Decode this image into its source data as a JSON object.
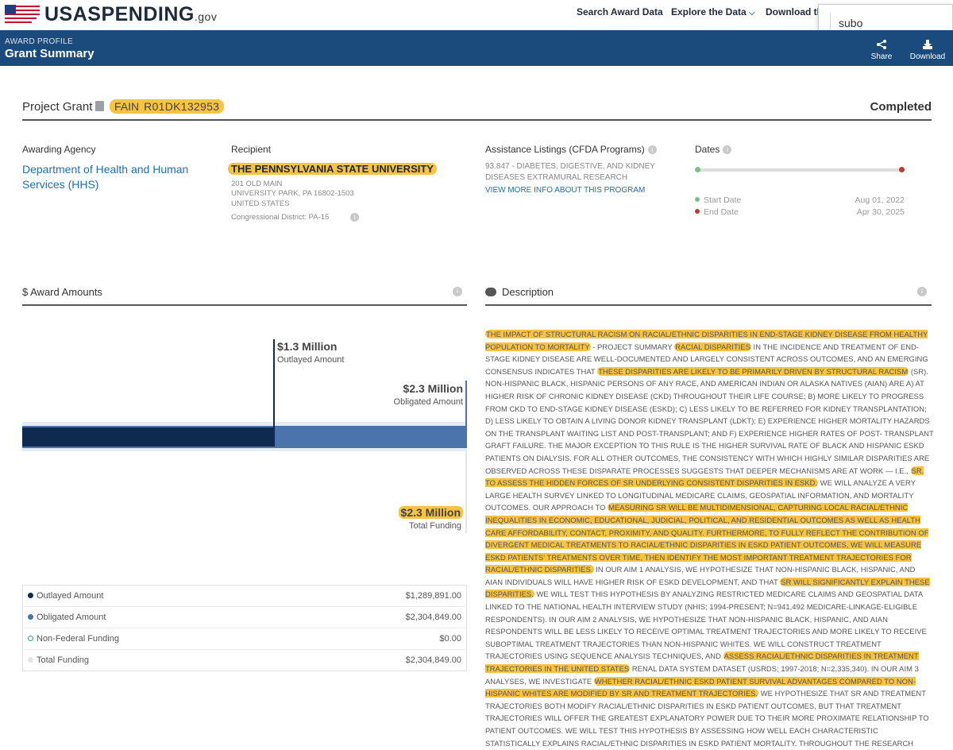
{
  "nav": {
    "logo_text": "USASPENDING",
    "logo_suffix": ".gov",
    "links": [
      "Search Award Data",
      "Explore the Data",
      "Download th"
    ],
    "explore_chevron": "⌵",
    "search_value": "subo"
  },
  "header": {
    "eyebrow": "AWARD PROFILE",
    "title": "Grant Summary",
    "share_label": "Share",
    "download_label": "Download"
  },
  "summary": {
    "award_type": "Project Grant",
    "fain_label": "FAIN",
    "fain_value": "R01DK132953",
    "status": "Completed",
    "awarding_agency_label": "Awarding Agency",
    "awarding_agency": "Department of Health and Human Services (HHS)",
    "recipient_label": "Recipient",
    "recipient_name": "THE PENNSYLVANIA STATE UNIVERSITY",
    "address_line1": "201 OLD MAIN",
    "address_line2": "UNIVERSITY PARK, PA 16802-1503",
    "address_line3": "UNITED STATES",
    "congressional_district": "Congressional District: PA-15",
    "cfda_label": "Assistance Listings (CFDA Programs)",
    "cfda_program": "93.847 - DIABETES, DIGESTIVE, AND KIDNEY DISEASES EXTRAMURAL RESEARCH",
    "cfda_link": "VIEW MORE INFO ABOUT THIS PROGRAM",
    "dates_label": "Dates",
    "start_label": "Start Date",
    "start_value": "Aug 01, 2022",
    "end_label": "End Date",
    "end_value": "Apr 30, 2025"
  },
  "amounts": {
    "section_title": "$ Award Amounts",
    "outlayed_big": "$1.3 Million",
    "outlayed_caption": "Outlayed Amount",
    "obligated_big": "$2.3 Million",
    "obligated_caption": "Obligated Amount",
    "total_big": "$2.3 Million",
    "total_caption": "Total Funding",
    "outlayed_fraction": 0.56,
    "obligated_fraction": 1.0,
    "legend": [
      {
        "label": "Outlayed Amount",
        "value": "$1,289,891.00",
        "color": "#0e2a4e"
      },
      {
        "label": "Obligated Amount",
        "value": "$2,304,849.00",
        "color": "#4b74ad"
      },
      {
        "label": "Non-Federal Funding",
        "value": "$0.00",
        "color": "#2aa198"
      },
      {
        "label": "Total Funding",
        "value": "$2,304,849.00",
        "color": "#e2e6ea"
      }
    ]
  },
  "description": {
    "section_title": "Description",
    "segments": [
      {
        "t": "THE IMPACT OF STRUCTURAL RACISM ON RACIAL/ETHNIC DISPARITIES IN END-STAGE KIDNEY DISEASE FROM HEALTHY POPULATION TO MORTALITY",
        "h": true
      },
      {
        "t": " - PROJECT SUMMARY ",
        "h": false
      },
      {
        "t": "RACIAL DISPARITIES",
        "h": true
      },
      {
        "t": " IN THE INCIDENCE AND TREATMENT OF END-STAGE KIDNEY DISEASE ARE WELL-DOCUMENTED AND LARGELY CONSISTENT ACROSS OUTCOMES, AND AN EMERGING CONSENSUS INDICATES THAT ",
        "h": false
      },
      {
        "t": "THESE DISPARITIES ARE LIKELY TO BE PRIMARILY DRIVEN BY STRUCTURAL RACISM",
        "h": true
      },
      {
        "t": " (SR). NON-HISPANIC BLACK, HISPANIC PERSONS OF ANY RACE, AND AMERICAN INDIAN OR ALASKA NATIVES (AIAN) ARE A) AT HIGHER RISK OF CHRONIC KIDNEY DISEASE (CKD) THROUGHOUT THEIR LIFE COURSE; B) MORE LIKELY TO PROGRESS FROM CKD TO END-STAGE KIDNEY DISEASE (ESKD); C) LESS LIKELY TO BE REFERRED FOR KIDNEY TRANSPLANTATION; D) LESS LIKELY TO OBTAIN A LIVING DONOR KIDNEY TRANSPLANT (LDKT); E) EXPERIENCE HIGHER MORTALITY HAZARDS ON THE TRANSPLANT WAITING LIST AND POST-TRANSPLANT; AND F) EXPERIENCE HIGHER RATES OF POST- TRANSPLANT GRAFT FAILURE. THE MAJOR EXCEPTION TO THIS RULE IS THE HIGHER SURVIVAL RATE OF BLACK AND HISPANIC ESKD PATIENTS ON DIALYSIS. FOR ALL OTHER OUTCOMES, THE CONSISTENCY WITH WHICH HIGHLY SIMILAR DISPARITIES ARE OBSERVED ACROSS THESE DISPARATE PROCESSES SUGGESTS THAT DEEPER MECHANISMS ARE AT WORK — I.E., ",
        "h": false
      },
      {
        "t": "SR. TO ASSESS THE HIDDEN FORCES OF SR UNDERLYING CONSISTENT DISPARITIES IN ESKD,",
        "h": true
      },
      {
        "t": " WE WILL ANALYZE A VERY LARGE HEALTH SURVEY LINKED TO LONGITUDINAL MEDICARE CLAIMS, GEOSPATIAL INFORMATION, AND MORTALITY OUTCOMES. OUR APPROACH TO ",
        "h": false
      },
      {
        "t": "MEASURING SR WILL BE MULTIDIMENSIONAL, CAPTURING LOCAL RACIAL/ETHNIC INEQUALITIES IN ECONOMIC, EDUCATIONAL, JUDICIAL, POLITICAL, AND RESIDENTIAL OUTCOMES AS WELL AS HEALTH CARE AFFORDABILITY, CONTACT, PROXIMITY, AND QUALITY. FURTHERMORE, TO FULLY REFLECT THE CONTRIBUTION OF DIVERGENT MEDICAL TREATMENTS TO RACIAL/ETHNIC DISPARITIES IN ESKD PATIENT OUTCOMES, WE WILL MEASURE ESKD PATIENTS' TREATMENTS OVER TIME, THEN IDENTIFY THE MOST IMPORTANT TREATMENT TRAJECTORIES FOR RACIAL/ETHNIC DISPARITIES.",
        "h": true
      },
      {
        "t": " IN OUR AIM 1 ANALYSIS, WE HYPOTHESIZE THAT NON-HISPANIC BLACK, HISPANIC, AND AIAN INDIVIDUALS WILL HAVE HIGHER RISK OF ESKD DEVELOPMENT, AND THAT ",
        "h": false
      },
      {
        "t": "SR WILL SIGNIFICANTLY EXPLAIN THESE DISPARITIES.",
        "h": true
      },
      {
        "t": " WE WILL TEST THIS HYPOTHESIS BY ANALYZING RESTRICTED MEDICARE CLAIMS AND GEOSPATIAL DATA LINKED TO THE NATIONAL HEALTH INTERVIEW STUDY (NHIS; 1994-PRESENT; N=941,492 MEDICARE-LINKAGE-ELIGIBLE RESPONDENTS). IN OUR AIM 2 ANALYSIS, WE HYPOTHESIZE THAT NON-HISPANIC BLACK, HISPANIC, AND AIAN RESPONDENTS WILL BE LESS LIKELY TO RECEIVE OPTIMAL TREATMENT TRAJECTORIES AND MORE LIKELY TO RECEIVE SUBOPTIMAL TREATMENT TRAJECTORIES THAN NON-HISPANIC WHITES. WE WILL CONSTRUCT TREATMENT TRAJECTORIES USING SEQUENCE ANALYSIS TECHNIQUES, AND ",
        "h": false
      },
      {
        "t": "ASSESS RACIAL/ETHNIC DISPARITIES IN TREATMENT TRAJECTORIES IN THE UNITED STATES",
        "h": true
      },
      {
        "t": " RENAL DATA SYSTEM DATASET (USRDS; 1997-2018; N=2,335,340). IN OUR AIM 3 ANALYSES, WE INVESTIGATE ",
        "h": false
      },
      {
        "t": "WHETHER RACIAL/ETHNIC ESKD PATIENT SURVIVAL ADVANTAGES COMPARED TO NON-HISPANIC WHITES ARE MODIFIED BY SR AND TREATMENT TRAJECTORIES.",
        "h": true
      },
      {
        "t": " WE HYPOTHESIZE THAT SR AND TREATMENT TRAJECTORIES BOTH MODIFY RACIAL/ETHNIC DISPARITIES IN ESKD PATIENT OUTCOMES, BUT THAT TREATMENT TRAJECTORIES WILL OFFER THE GREATEST EXPLANATORY POWER DUE TO THEIR MORE PROXIMATE RELATIONSHIP TO PATIENT OUTCOMES. WE WILL TEST THIS HYPOTHESIS BY ASSESSING HOW WELL EACH CHARACTERISTIC STATISTICALLY EXPLAINS RACIAL/ETHNIC DISPARITIES IN ESKD PATIENT MORTALITY. THROUGHOUT THE RESEARCH PROCESS WE WILL WORK WITH TWO ESTABLISHED COMMUNITY ADVISORY BOARDS TO GENERATE NOVEL IDEAS FOR ANALYSES, RESULTS INTERPRETATION, AND SPECIFIC PROPOSED INTERVENTIONS, AND REFINE THE PROPOSED INTERVENTIONS FOR FUTURE TESTING WITH INPUT FROM THE BOARD AND ESKD HEALTH CARE PROFESSIONALS.",
        "h": false
      }
    ]
  },
  "colors": {
    "header_blue": "#1b4a7d",
    "highlight": "#f6c343",
    "link_blue": "#1f6fb5",
    "start_dot": "#7bbf8a",
    "end_dot": "#c0392b"
  }
}
